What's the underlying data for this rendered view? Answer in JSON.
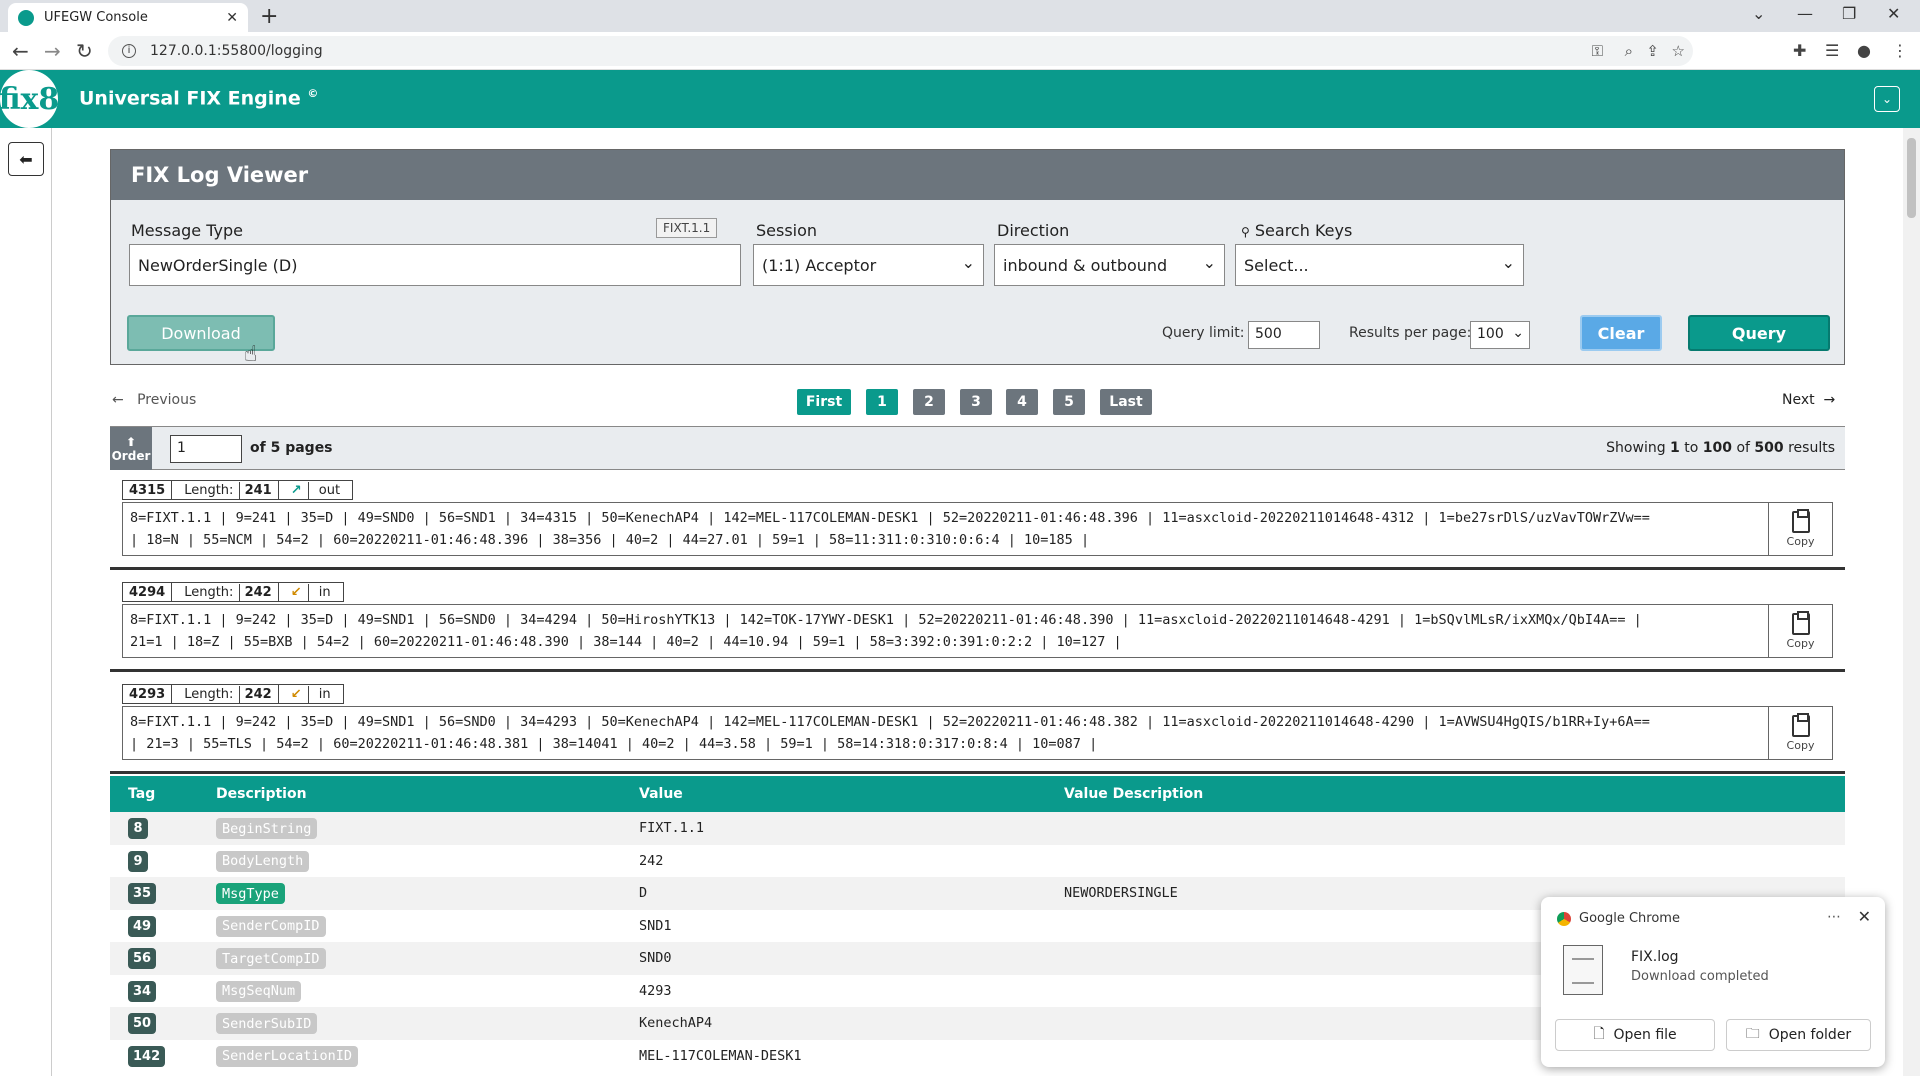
{
  "browser": {
    "tab_title": "UFEGW Console",
    "url": "127.0.0.1:55800/logging"
  },
  "app": {
    "title": "Universal FIX Engine",
    "copyright": "©",
    "logo_text": "fix8"
  },
  "viewer": {
    "title": "FIX Log Viewer",
    "message_type_label": "Message Type",
    "message_type_value": "NewOrderSingle (D)",
    "fixt_badge": "FIXT.1.1",
    "session_label": "Session",
    "session_value": "(1:1) Acceptor",
    "direction_label": "Direction",
    "direction_value": "inbound & outbound",
    "search_keys_label": "Search Keys",
    "search_keys_value": "Select...",
    "download_label": "Download",
    "query_limit_label": "Query limit:",
    "query_limit_value": "500",
    "results_per_page_label": "Results per page:",
    "results_per_page_value": "100",
    "clear_label": "Clear",
    "query_label": "Query"
  },
  "pagination": {
    "previous": "Previous",
    "next": "Next",
    "first": "First",
    "pages": [
      "1",
      "2",
      "3",
      "4",
      "5"
    ],
    "last": "Last",
    "current_page_input": "1",
    "of_pages": "of 5 pages",
    "order_label": "Order",
    "showing_prefix": "Showing ",
    "showing_from": "1",
    "showing_to_word": " to ",
    "showing_to": "100",
    "showing_of_word": " of ",
    "showing_total": "500",
    "showing_suffix": " results"
  },
  "entries": [
    {
      "seq": "4315",
      "length_label": "Length:",
      "length": "241",
      "direction": "out",
      "line1": "8=FIXT.1.1 | 9=241 | 35=D | 49=SND0 | 56=SND1 | 34=4315 | 50=KenechAP4 | 142=MEL-117COLEMAN-DESK1 | 52=20220211-01:46:48.396 | 11=asxcloid-20220211014648-4312 | 1=be27srDlS/uzVavTOWrZVw==",
      "line2": "| 18=N | 55=NCM | 54=2 | 60=20220211-01:46:48.396 | 38=356 | 40=2 | 44=27.01 | 59=1 | 58=11:311:0:310:0:6:4 | 10=185 |",
      "copy_label": "Copy"
    },
    {
      "seq": "4294",
      "length_label": "Length:",
      "length": "242",
      "direction": "in",
      "line1": "8=FIXT.1.1 | 9=242 | 35=D | 49=SND1 | 56=SND0 | 34=4294 | 50=HiroshYTK13 | 142=TOK-17YWY-DESK1 | 52=20220211-01:46:48.390 | 11=asxcloid-20220211014648-4291 | 1=bSQvlMLsR/ixXMQx/QbI4A== |",
      "line2": "21=1 | 18=Z | 55=BXB | 54=2 | 60=20220211-01:46:48.390 | 38=144 | 40=2 | 44=10.94 | 59=1 | 58=3:392:0:391:0:2:2 | 10=127 |",
      "copy_label": "Copy"
    },
    {
      "seq": "4293",
      "length_label": "Length:",
      "length": "242",
      "direction": "in",
      "line1": "8=FIXT.1.1 | 9=242 | 35=D | 49=SND1 | 56=SND0 | 34=4293 | 50=KenechAP4 | 142=MEL-117COLEMAN-DESK1 | 52=20220211-01:46:48.382 | 11=asxcloid-20220211014648-4290 | 1=AVWSU4HgQIS/b1RR+Iy+6A==",
      "line2": "| 21=3 | 55=TLS | 54=2 | 60=20220211-01:46:48.381 | 38=14041 | 40=2 | 44=3.58 | 59=1 | 58=14:318:0:317:0:8:4 | 10=087 |",
      "copy_label": "Copy"
    }
  ],
  "table": {
    "headers": {
      "tag": "Tag",
      "description": "Description",
      "value": "Value",
      "value_description": "Value Description"
    },
    "rows": [
      {
        "tag": "8",
        "desc": "BeginString",
        "value": "FIXT.1.1",
        "vdesc": ""
      },
      {
        "tag": "9",
        "desc": "BodyLength",
        "value": "242",
        "vdesc": ""
      },
      {
        "tag": "35",
        "desc": "MsgType",
        "value": "D",
        "vdesc": "NEWORDERSINGLE"
      },
      {
        "tag": "49",
        "desc": "SenderCompID",
        "value": "SND1",
        "vdesc": ""
      },
      {
        "tag": "56",
        "desc": "TargetCompID",
        "value": "SND0",
        "vdesc": ""
      },
      {
        "tag": "34",
        "desc": "MsgSeqNum",
        "value": "4293",
        "vdesc": ""
      },
      {
        "tag": "50",
        "desc": "SenderSubID",
        "value": "KenechAP4",
        "vdesc": ""
      },
      {
        "tag": "142",
        "desc": "SenderLocationID",
        "value": "MEL-117COLEMAN-DESK1",
        "vdesc": ""
      }
    ]
  },
  "download_popup": {
    "app": "Google Chrome",
    "file": "FIX.log",
    "status": "Download completed",
    "open_file": "Open file",
    "open_folder": "Open folder"
  },
  "colors": {
    "brand": "#0a9a8c",
    "panel_header": "#6c757d",
    "clear_button": "#5aa9e6",
    "query_button": "#0a9a8c",
    "download_button": "#7dbdb2",
    "page_active": "#0a9a8c",
    "page_inactive": "#6c757d"
  }
}
